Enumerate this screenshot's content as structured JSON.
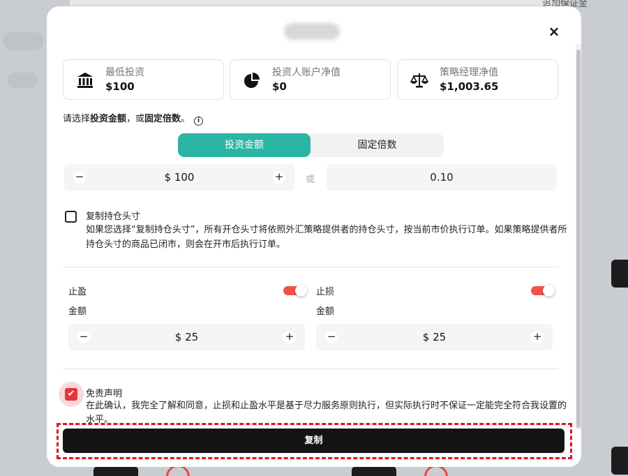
{
  "background": {
    "top_right_text": "追加保证金"
  },
  "modal": {
    "close_glyph": "×",
    "stats": [
      {
        "icon": "bank-icon",
        "label": "最低投资",
        "value": "$100"
      },
      {
        "icon": "pie-chart-icon",
        "label": "投资人账户净值",
        "value": "$0"
      },
      {
        "icon": "balance-scale-icon",
        "label": "策略经理净值",
        "value": "$1,003.65"
      }
    ],
    "instruction": {
      "prefix": "请选择",
      "bold1": "投资金额",
      "middle": "，或",
      "bold2": "固定倍数",
      "suffix": "。",
      "info_glyph": "i"
    },
    "mode_tabs": [
      {
        "label": "投资金额",
        "active": true
      },
      {
        "label": "固定倍数",
        "active": false
      }
    ],
    "amount_stepper": {
      "minus": "−",
      "value": "$ 100",
      "plus": "+"
    },
    "or_label": "或",
    "multiplier_value": "0.10",
    "copy_position": {
      "checked": false,
      "title": "复制持仓头寸",
      "description": "如果您选择“复制持仓头寸”，所有开仓头寸将依照外汇策略提供者的持仓头寸，按当前市价执行订单。如果策略提供者所持仓头寸的商品已闭市，则会在开市后执行订单。"
    },
    "take_profit": {
      "label": "止盈",
      "enabled": true,
      "amount_label": "金额",
      "minus": "−",
      "value": "$ 25",
      "plus": "+"
    },
    "stop_loss": {
      "label": "止损",
      "enabled": true,
      "amount_label": "金额",
      "minus": "−",
      "value": "$ 25",
      "plus": "+"
    },
    "disclaimer": {
      "checked": true,
      "check_glyph": "✔",
      "title": "免责声明",
      "description": "在此确认，我完全了解和同意，止损和止盈水平是基于尽力服务原则执行，但实际执行时不保证一定能完全符合我设置的水平。"
    },
    "submit_label": "复制"
  },
  "colors": {
    "accent": "#2ab5a4",
    "toggle_on": "#f0524a",
    "checkbox_checked": "#e8343a",
    "button_dark": "#141414",
    "highlight_dashed": "#e0141b"
  }
}
